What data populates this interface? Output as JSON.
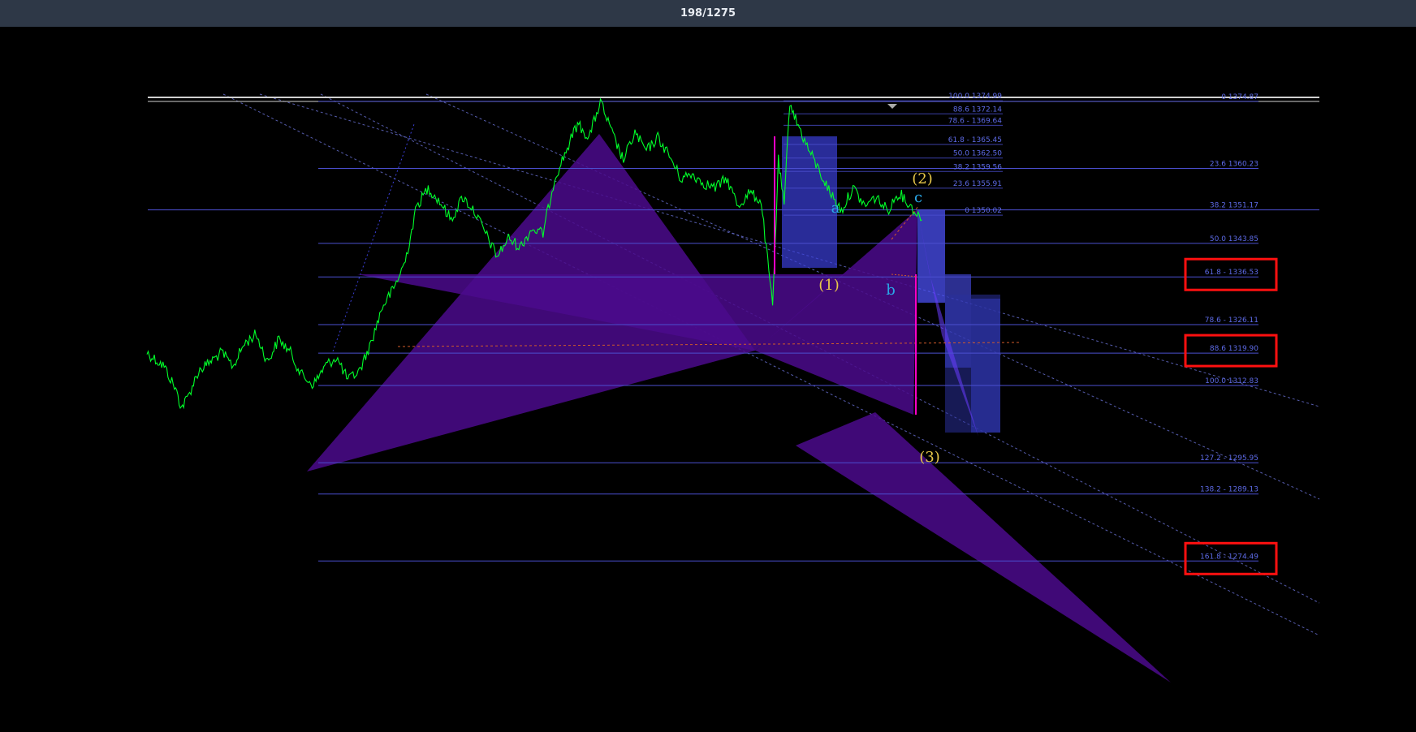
{
  "viewer": {
    "counter": "198/1275"
  },
  "colors": {
    "background": "#000000",
    "topbar": "#2e3847",
    "price": "#00ff2a",
    "fib_line": "#4b4fd0",
    "fib_text": "#5d6ae6",
    "pattern": "#4b0a8c",
    "zone": "#3b3fd8",
    "wave_yellow": "#e8c84a",
    "wave_cyan": "#2aa8e8",
    "highlight_box": "#ff1010",
    "vertical_marker": "#ff00c8"
  },
  "chart_data": {
    "type": "line",
    "y_axis": "price",
    "ylim": [
      1265,
      1385
    ],
    "fib_right": [
      {
        "label": "0 1374.87",
        "level": 1374.87
      },
      {
        "label": "23.6 1360.23",
        "level": 1360.23
      },
      {
        "label": "38.2 1351.17",
        "level": 1351.17
      },
      {
        "label": "50.0 1343.85",
        "level": 1343.85
      },
      {
        "label": "61.8 - 1336.53",
        "level": 1336.53,
        "highlighted": true
      },
      {
        "label": "78.6 - 1326.11",
        "level": 1326.11
      },
      {
        "label": "88.6 1319.90",
        "level": 1319.9,
        "highlighted": true
      },
      {
        "label": "100.0 1312.83",
        "level": 1312.83
      },
      {
        "label": "127.2 - 1295.95",
        "level": 1295.95
      },
      {
        "label": "138.2 - 1289.13",
        "level": 1289.13
      },
      {
        "label": "161.8 - 1274.49",
        "level": 1274.49,
        "highlighted": true
      }
    ],
    "fib_inner": [
      {
        "label": "100.0 1374.99",
        "level": 1374.99
      },
      {
        "label": "88.6 1372.14",
        "level": 1372.14
      },
      {
        "label": "78.6 - 1369.64",
        "level": 1369.64
      },
      {
        "label": "61.8 - 1365.45",
        "level": 1365.45
      },
      {
        "label": "50.0 1362.50",
        "level": 1362.5
      },
      {
        "label": "38.2 1359.56",
        "level": 1359.56
      },
      {
        "label": "23.6 1355.91",
        "level": 1355.91
      },
      {
        "label": "0 1350.02",
        "level": 1350.02
      }
    ],
    "wave_labels": [
      {
        "text": "(2)",
        "color": "yellow"
      },
      {
        "text": "c",
        "color": "cyan"
      },
      {
        "text": "a",
        "color": "cyan"
      },
      {
        "text": "(1)",
        "color": "yellow"
      },
      {
        "text": "b",
        "color": "cyan"
      },
      {
        "text": "(3)",
        "color": "yellow"
      }
    ],
    "price_path": [
      [
        0,
        1320
      ],
      [
        3,
        1317
      ],
      [
        5,
        1312
      ],
      [
        6,
        1308
      ],
      [
        7,
        1310
      ],
      [
        9,
        1316
      ],
      [
        11,
        1318
      ],
      [
        13,
        1320
      ],
      [
        15,
        1317
      ],
      [
        17,
        1322
      ],
      [
        19,
        1324
      ],
      [
        21,
        1318
      ],
      [
        23,
        1323
      ],
      [
        25,
        1320
      ],
      [
        27,
        1315
      ],
      [
        29,
        1313
      ],
      [
        31,
        1317
      ],
      [
        33,
        1319
      ],
      [
        35,
        1314
      ],
      [
        37,
        1316
      ],
      [
        39,
        1322
      ],
      [
        41,
        1330
      ],
      [
        43,
        1334
      ],
      [
        45,
        1340
      ],
      [
        47,
        1352
      ],
      [
        49,
        1356
      ],
      [
        51,
        1353
      ],
      [
        53,
        1349
      ],
      [
        55,
        1354
      ],
      [
        57,
        1351
      ],
      [
        59,
        1346
      ],
      [
        61,
        1341
      ],
      [
        63,
        1345
      ],
      [
        65,
        1343
      ],
      [
        67,
        1347
      ],
      [
        69,
        1346
      ],
      [
        71,
        1358
      ],
      [
        73,
        1364
      ],
      [
        75,
        1370
      ],
      [
        77,
        1367
      ],
      [
        79,
        1374.8
      ],
      [
        81,
        1368
      ],
      [
        83,
        1362
      ],
      [
        85,
        1368
      ],
      [
        87,
        1364
      ],
      [
        89,
        1367
      ],
      [
        91,
        1363
      ],
      [
        93,
        1358
      ],
      [
        95,
        1359
      ],
      [
        97,
        1357
      ],
      [
        99,
        1356
      ],
      [
        101,
        1358
      ],
      [
        103,
        1352
      ],
      [
        105,
        1355
      ],
      [
        107,
        1353
      ],
      [
        109,
        1330
      ],
      [
        110,
        1362
      ],
      [
        111,
        1352
      ],
      [
        112,
        1375
      ],
      [
        113,
        1371
      ],
      [
        115,
        1365
      ],
      [
        117,
        1360
      ],
      [
        119,
        1355
      ],
      [
        121,
        1351
      ],
      [
        123,
        1356
      ],
      [
        125,
        1352
      ],
      [
        127,
        1354
      ],
      [
        129,
        1351
      ],
      [
        131,
        1355
      ],
      [
        133,
        1352
      ],
      [
        135,
        1349
      ]
    ]
  }
}
